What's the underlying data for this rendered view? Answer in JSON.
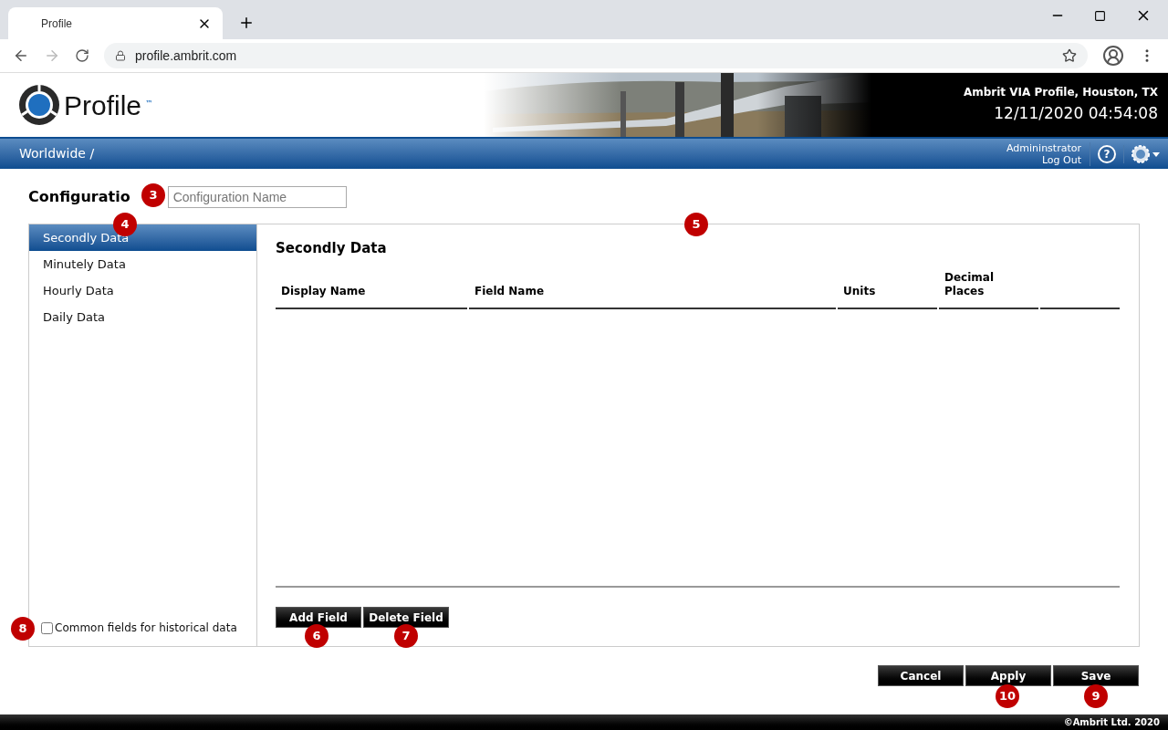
{
  "browser": {
    "tab_title": "Profile",
    "url": "profile.ambrit.com"
  },
  "header": {
    "logo_text": "Profile",
    "trademark": "™",
    "site": "Ambrit VIA Profile, Houston, TX",
    "datetime": "12/11/2020 04:54:08"
  },
  "nav": {
    "breadcrumb": "Worldwide /",
    "user": "Admininstrator",
    "logout": "Log Out",
    "help": "?"
  },
  "heading": "Configuratio",
  "name_field": {
    "placeholder": "Configuration Name"
  },
  "sidebar": {
    "items": [
      {
        "label": "Secondly Data",
        "selected": true
      },
      {
        "label": "Minutely Data",
        "selected": false
      },
      {
        "label": "Hourly Data",
        "selected": false
      },
      {
        "label": "Daily Data",
        "selected": false
      }
    ],
    "common_fields": {
      "label": "Common fields for historical data",
      "checked": false
    }
  },
  "panel": {
    "title": "Secondly Data",
    "columns": [
      "Display Name",
      "Field Name",
      "Units",
      "Decimal Places",
      ""
    ],
    "buttons": [
      "Add Field",
      "Delete Field"
    ]
  },
  "footer_buttons": [
    "Cancel",
    "Apply",
    "Save"
  ],
  "copyright": "©Ambrit Ltd. 2020",
  "callouts": [
    "3",
    "4",
    "5",
    "6",
    "7",
    "8",
    "9",
    "10"
  ]
}
